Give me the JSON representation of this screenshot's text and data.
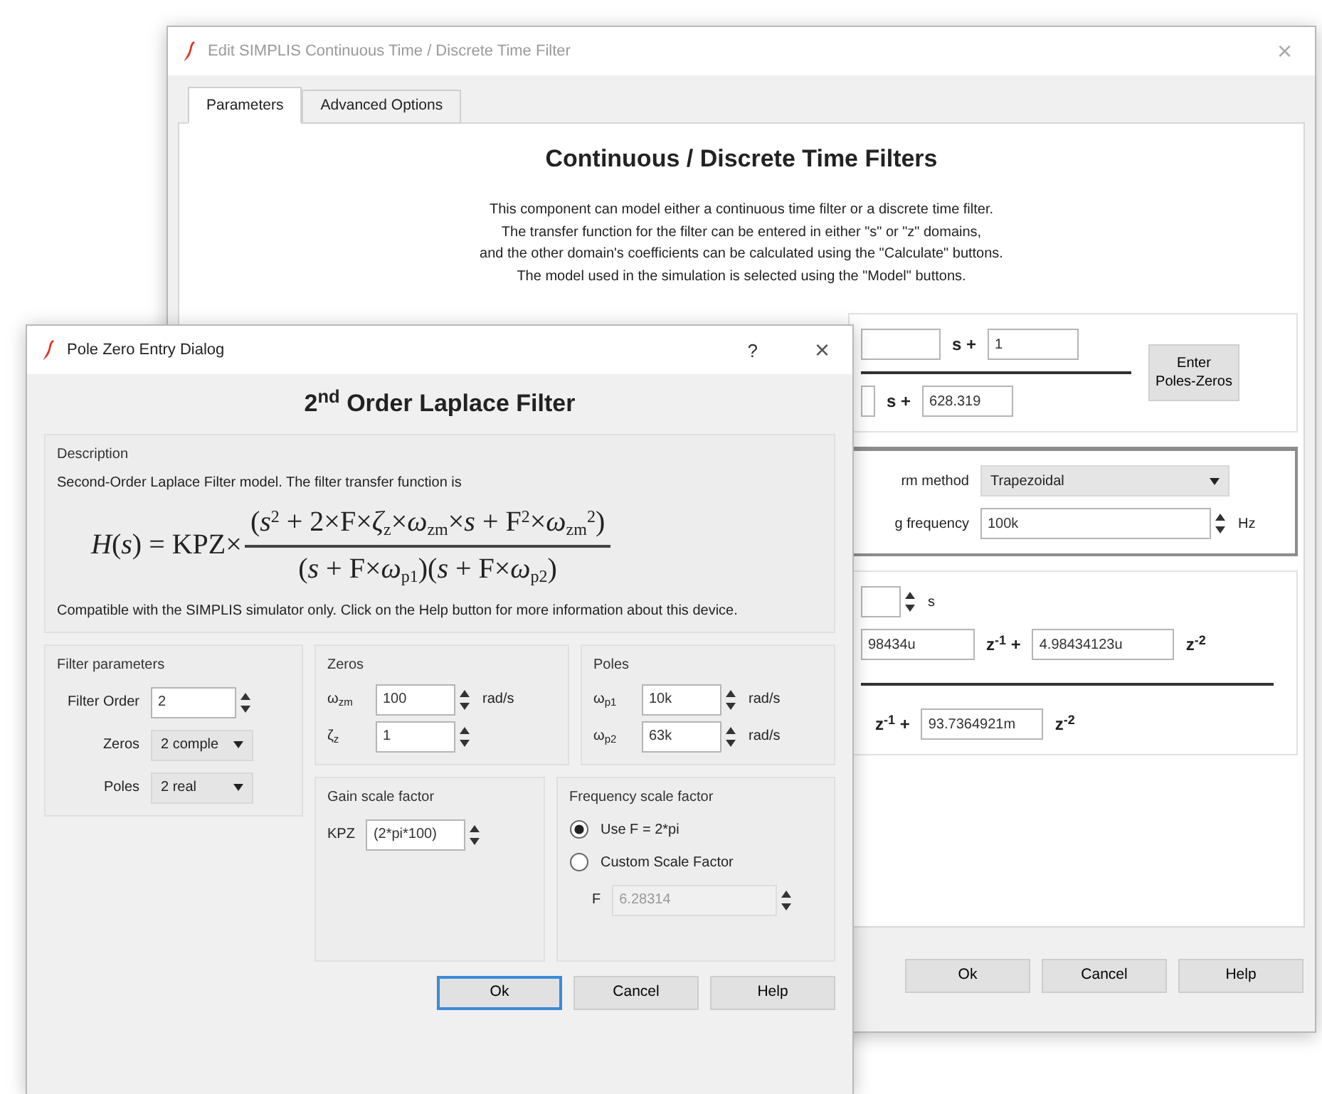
{
  "back_window": {
    "title": "Edit SIMPLIS Continuous Time / Discrete Time Filter",
    "close": "×",
    "tabs": [
      {
        "label": "Parameters",
        "selected": true
      },
      {
        "label": "Advanced Options",
        "selected": false
      }
    ],
    "heading": "Continuous / Discrete Time Filters",
    "description": [
      "This component can model either a continuous time filter or a discrete time filter.",
      "The transfer function for the filter can be entered in either \"s\" or \"z\" domains,",
      "and the other domain's coefficients can be calculated using the \"Calculate\" buttons.",
      "The model used in the simulation is selected using the \"Model\" buttons."
    ],
    "s_numerator": [
      {
        "kind": "field"
      },
      {
        "kind": "op",
        "text": "s +"
      },
      {
        "kind": "field",
        "value": "1"
      }
    ],
    "enter_button": "Enter Poles-Zeros",
    "s_denominator": [
      {
        "kind": "field"
      },
      {
        "kind": "op",
        "text": "s +"
      },
      {
        "kind": "field",
        "value": "628.319"
      }
    ],
    "transform": {
      "label": "rm method",
      "value": "Trapezoidal"
    },
    "sampling": {
      "label": "g frequency",
      "value": "100k",
      "unit": "Hz"
    },
    "delay": {
      "unit": "s"
    },
    "z_numerator": [
      {
        "kind": "field",
        "value": "98434u"
      },
      {
        "kind": "op",
        "text": "z$^{-1}$ +"
      },
      {
        "kind": "field",
        "value": "4.98434123u"
      },
      {
        "kind": "op",
        "text": "z$^{-2}$"
      }
    ],
    "z_denominator": [
      {
        "kind": "op",
        "text": "z$^{-1}$ +"
      },
      {
        "kind": "field",
        "value": "93.7364921m"
      },
      {
        "kind": "op",
        "text": "z$^{-2}$"
      }
    ],
    "buttons": [
      {
        "label": "Ok",
        "default": false
      },
      {
        "label": "Cancel",
        "default": false
      },
      {
        "label": "Help",
        "default": false
      }
    ]
  },
  "dialog": {
    "title": "Pole Zero Entry Dialog",
    "help": "?",
    "close": "×",
    "heading": "2$^{nd}$ Order Laplace Filter",
    "description": {
      "title": "Description",
      "intro": "Second-Order Laplace Filter model. The filter transfer function is",
      "formula": {
        "lhs": "*H*(*s*) = KPZ×",
        "numerator": "(*s*$^{2}$ + 2×F×*ζ*$_{z}$×*ω*$_{zm}$×*s* + F$^{2}$×*ω*$_{zm}$$^{2}$)",
        "denominator": "(*s* + F×*ω*$_{p1}$)(*s* + F×*ω*$_{p2}$)"
      },
      "note": "Compatible with the SIMPLIS simulator only. Click on the Help button for more information about this device."
    },
    "filter_parameters": {
      "title": "Filter parameters",
      "rows": [
        {
          "label": "Filter Order",
          "kind": "spin",
          "value": "2"
        },
        {
          "label": "Zeros",
          "kind": "select",
          "value": "2 comple"
        },
        {
          "label": "Poles",
          "kind": "select",
          "value": "2 real"
        }
      ]
    },
    "zeros": {
      "title": "Zeros",
      "rows": [
        {
          "label": "ω$_{zm}$",
          "value": "100",
          "unit": "rad/s"
        },
        {
          "label": "ζ$_{z}$",
          "value": "1"
        }
      ]
    },
    "poles": {
      "title": "Poles",
      "rows": [
        {
          "label": "ω$_{p1}$",
          "value": "10k",
          "unit": "rad/s"
        },
        {
          "label": "ω$_{p2}$",
          "value": "63k",
          "unit": "rad/s"
        }
      ]
    },
    "gain": {
      "title": "Gain scale factor",
      "label": "KPZ",
      "value": "(2*pi*100)"
    },
    "frequency": {
      "title": "Frequency scale factor",
      "options": [
        {
          "label": "Use F = 2*pi",
          "selected": true
        },
        {
          "label": "Custom Scale Factor",
          "selected": false
        }
      ],
      "field": {
        "label": "F",
        "value": "6.28314",
        "disabled": true
      }
    },
    "buttons": [
      {
        "label": "Ok",
        "default": true
      },
      {
        "label": "Cancel",
        "default": false
      },
      {
        "label": "Help",
        "default": false
      }
    ]
  }
}
